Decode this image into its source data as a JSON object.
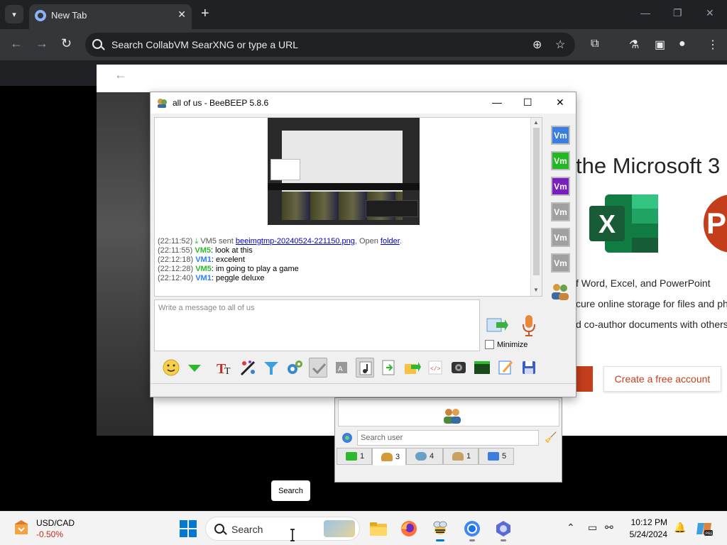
{
  "browser": {
    "tab_title": "New Tab",
    "tab_close": "✕",
    "new_tab": "+",
    "omnibox_text": "Search CollabVM SearXNG or type a URL",
    "back": "←",
    "forward": "→",
    "reload": "↻",
    "minimize": "—",
    "restore": "❐",
    "close": "✕"
  },
  "page": {
    "back": "←",
    "hero_heading": "the Microsoft 3",
    "features": [
      "f Word, Excel, and PowerPoint",
      "cure online storage for files and ph",
      "d co-author documents with others"
    ],
    "cta": "Create a free account"
  },
  "beebeep_chat": {
    "title": "all of us - BeeBEEP 5.8.6",
    "messages": [
      {
        "time": "(22:11:52)",
        "sender": "VM5",
        "text": " sent ",
        "link": "beeimgtmp-20240524-221150.png",
        "after": ", Open ",
        "link2": "folder",
        "end": "."
      },
      {
        "time": "(22:11:55)",
        "sender": "VM5",
        "text": ": look at this"
      },
      {
        "time": "(22:12:18)",
        "sender": "VM1",
        "text": ": excelent"
      },
      {
        "time": "(22:12:28)",
        "sender": "VM5",
        "text": ": im going to play a game"
      },
      {
        "time": "(22:12:40)",
        "sender": "VM1",
        "text": ": peggle deluxe"
      }
    ],
    "input_placeholder": "Write a message to all of us",
    "minimize_label": "Minimize",
    "users": [
      {
        "label": "Vm",
        "color": "#3a7ee0"
      },
      {
        "label": "Vm",
        "color": "#22b822"
      },
      {
        "label": "Vm",
        "color": "#7a1fbf"
      },
      {
        "label": "Vm",
        "color": "#a0a0a0"
      },
      {
        "label": "Vm",
        "color": "#a0a0a0"
      },
      {
        "label": "Vm",
        "color": "#a0a0a0"
      }
    ]
  },
  "beebeep_main": {
    "search_placeholder": "Search user",
    "tabs": [
      {
        "count": "1",
        "icon": "chat-icon"
      },
      {
        "count": "3",
        "icon": "users-icon"
      },
      {
        "count": "4",
        "icon": "groups-icon"
      },
      {
        "count": "1",
        "icon": "people-icon"
      },
      {
        "count": "5",
        "icon": "network-icon"
      }
    ]
  },
  "tooltip": "Search",
  "taskbar": {
    "stock_name": "USD/CAD",
    "stock_change": "-0.50%",
    "search_label": "Search",
    "time": "10:12 PM",
    "date": "5/24/2024"
  }
}
